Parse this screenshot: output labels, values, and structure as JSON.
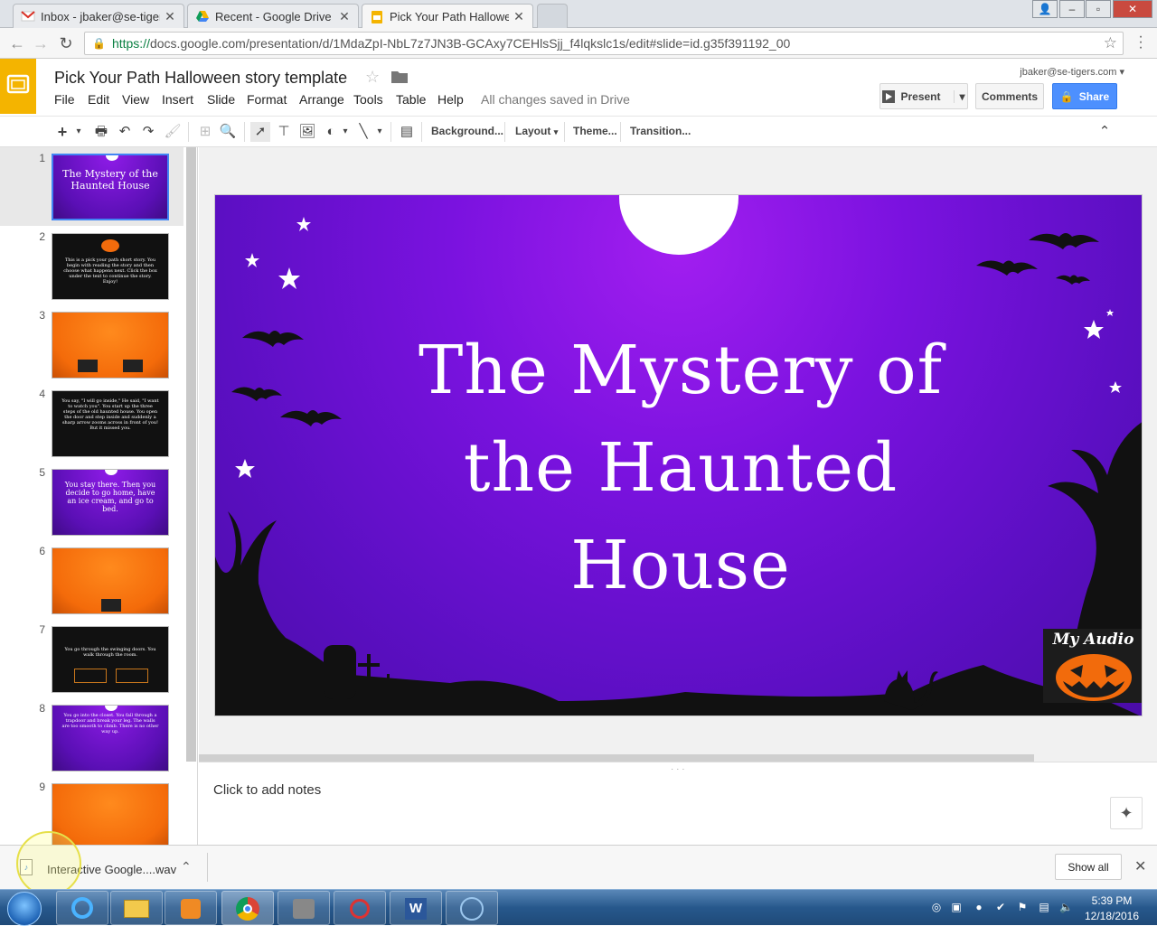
{
  "browser": {
    "tabs": [
      {
        "title": "Inbox - jbaker@se-tigers",
        "icon": "gmail-icon"
      },
      {
        "title": "Recent - Google Drive",
        "icon": "drive-icon"
      },
      {
        "title": "Pick Your Path Halloween",
        "icon": "slides-icon",
        "active": true
      }
    ],
    "url_scheme": "https://",
    "url_rest": "docs.google.com/presentation/d/1MdaZpI-NbL7z7JN3B-GCAxy7CEHlsSjj_f4lqkslc1s/edit#slide=id.g35f391192_00"
  },
  "app": {
    "title": "Pick Your Path Halloween story template",
    "menus": [
      "File",
      "Edit",
      "View",
      "Insert",
      "Slide",
      "Format",
      "Arrange",
      "Tools",
      "Table",
      "Help"
    ],
    "saved_status": "All changes saved in Drive",
    "account": "jbaker@se-tigers.com",
    "present_label": "Present",
    "comments_label": "Comments",
    "share_label": "Share",
    "brand_color": "#f4b400",
    "share_color": "#4d90fe"
  },
  "toolbar": {
    "background": "Background...",
    "layout": "Layout",
    "theme": "Theme...",
    "transition": "Transition..."
  },
  "filmstrip": {
    "slides": [
      {
        "num": "1",
        "style": "purple",
        "text": "The Mystery of the Haunted House"
      },
      {
        "num": "2",
        "style": "dark",
        "text": "This is a pick your path short story. You begin with reading the story and then choose what happens next. Click the box under the text to continue the story. Enjoy!"
      },
      {
        "num": "3",
        "style": "orange",
        "text": ""
      },
      {
        "num": "4",
        "style": "dark",
        "text": "You say, \"I will go inside,\" He said, \"I want to watch you\". You start up the three steps of the old haunted house. You open the door and step inside and suddenly a sharp arrow zooms across in front of you! But it missed you."
      },
      {
        "num": "5",
        "style": "purple",
        "text": "You stay there. Then you decide to go home, have an ice cream, and go to bed."
      },
      {
        "num": "6",
        "style": "orange",
        "text": ""
      },
      {
        "num": "7",
        "style": "dark",
        "text": "You go through the swinging doors. You walk through the room."
      },
      {
        "num": "8",
        "style": "purple",
        "text": "You go into the closet. You fall through a trapdoor and break your leg. The walls are too smooth to climb. There is no other way up."
      },
      {
        "num": "9",
        "style": "orange",
        "text": ""
      }
    ]
  },
  "slide": {
    "title_lines": [
      "The Mystery of",
      "the Haunted",
      "House"
    ],
    "audio_label": "My Audio"
  },
  "notes": {
    "placeholder": "Click to add notes"
  },
  "downloads": {
    "filename": "Interactive Google....wav",
    "show_all": "Show all"
  },
  "taskbar": {
    "time": "5:39 PM",
    "date": "12/18/2016"
  }
}
